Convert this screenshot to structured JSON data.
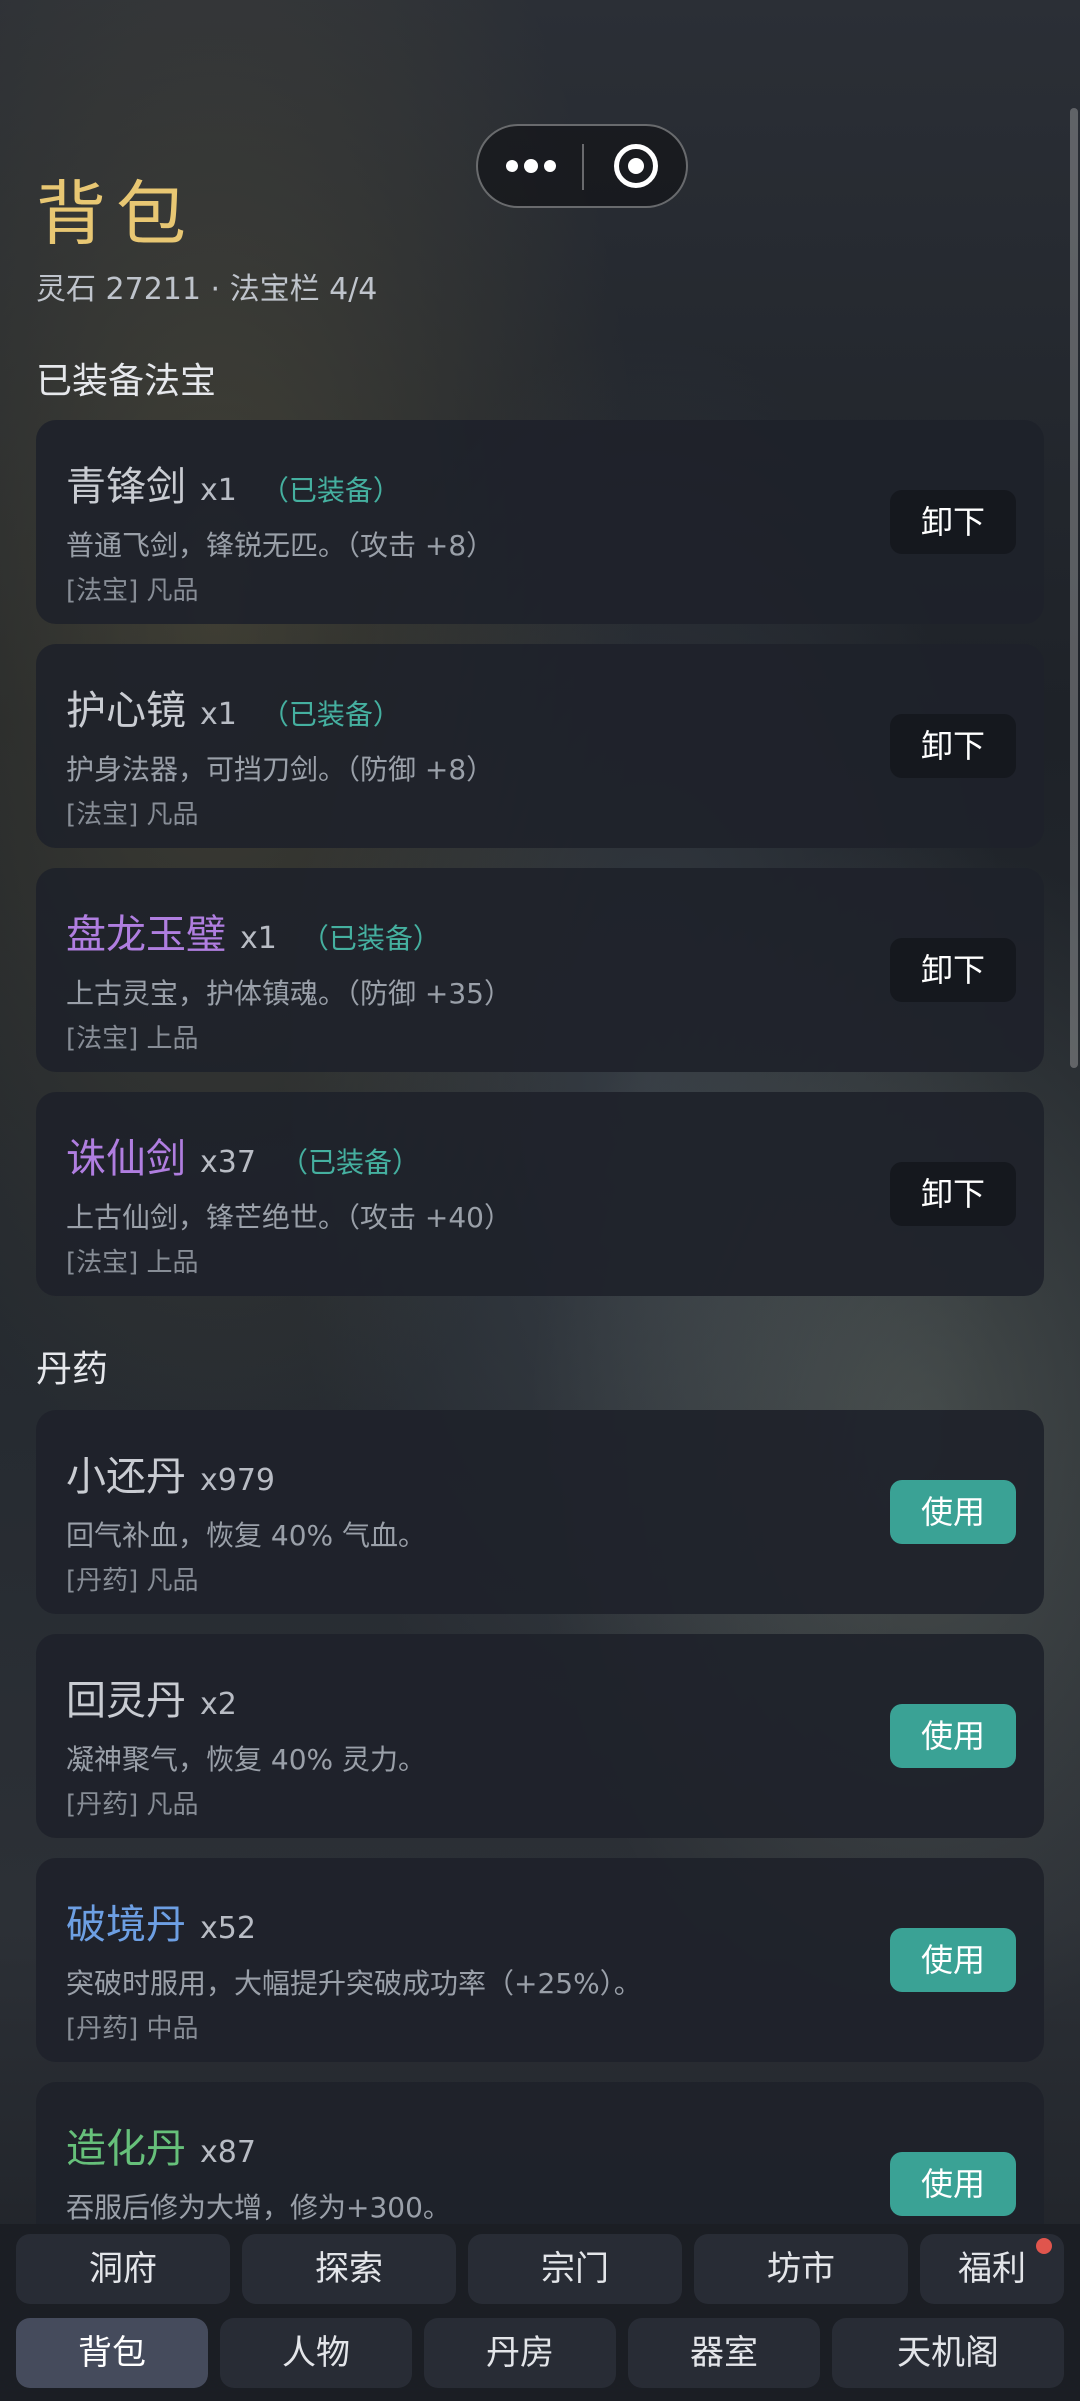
{
  "header": {
    "title": "背包",
    "subtitle": "灵石 27211 · 法宝栏 4/4"
  },
  "sections": {
    "equipped": "已装备法宝",
    "pills": "丹药"
  },
  "equipped_items": [
    {
      "name": "青锋剑",
      "qty": "x1",
      "status": "（已装备）",
      "desc": "普通飞剑，锋锐无匹。（攻击 +8）",
      "tag": "[法宝] 凡品",
      "button": "卸下"
    },
    {
      "name": "护心镜",
      "qty": "x1",
      "status": "（已装备）",
      "desc": "护身法器，可挡刀剑。（防御 +8）",
      "tag": "[法宝] 凡品",
      "button": "卸下"
    },
    {
      "name": "盘龙玉璧",
      "qty": "x1",
      "status": "（已装备）",
      "desc": "上古灵宝，护体镇魂。（防御 +35）",
      "tag": "[法宝] 上品",
      "button": "卸下"
    },
    {
      "name": "诛仙剑",
      "qty": "x37",
      "status": "（已装备）",
      "desc": "上古仙剑，锋芒绝世。（攻击 +40）",
      "tag": "[法宝] 上品",
      "button": "卸下"
    }
  ],
  "pill_items": [
    {
      "name": "小还丹",
      "qty": "x979",
      "desc": "回气补血，恢复 40% 气血。",
      "tag": "[丹药] 凡品",
      "button": "使用"
    },
    {
      "name": "回灵丹",
      "qty": "x2",
      "desc": "凝神聚气，恢复 40% 灵力。",
      "tag": "[丹药] 凡品",
      "button": "使用"
    },
    {
      "name": "破境丹",
      "qty": "x52",
      "desc": "突破时服用，大幅提升突破成功率（+25%）。",
      "tag": "[丹药] 中品",
      "button": "使用"
    },
    {
      "name": "造化丹",
      "qty": "x87",
      "desc": "吞服后修为大增，修为+300。",
      "tag": "",
      "button": "使用"
    }
  ],
  "nav": {
    "row1": [
      "洞府",
      "探索",
      "宗门",
      "坊市",
      "福利"
    ],
    "row2": [
      "背包",
      "人物",
      "丹房",
      "器室",
      "天机阁"
    ]
  },
  "colors": {
    "title": "#e8c773",
    "equipped_status": "#45b0a0",
    "use_button": "#3aa295",
    "rarity_common": "#c9ccd2",
    "rarity_purple": "#b07ee0",
    "rarity_blue": "#6d9fe3",
    "rarity_green": "#66c07a",
    "notification_dot": "#e0554d"
  },
  "icons": {
    "menu": "more-dots-icon",
    "close": "target-circle-icon"
  }
}
